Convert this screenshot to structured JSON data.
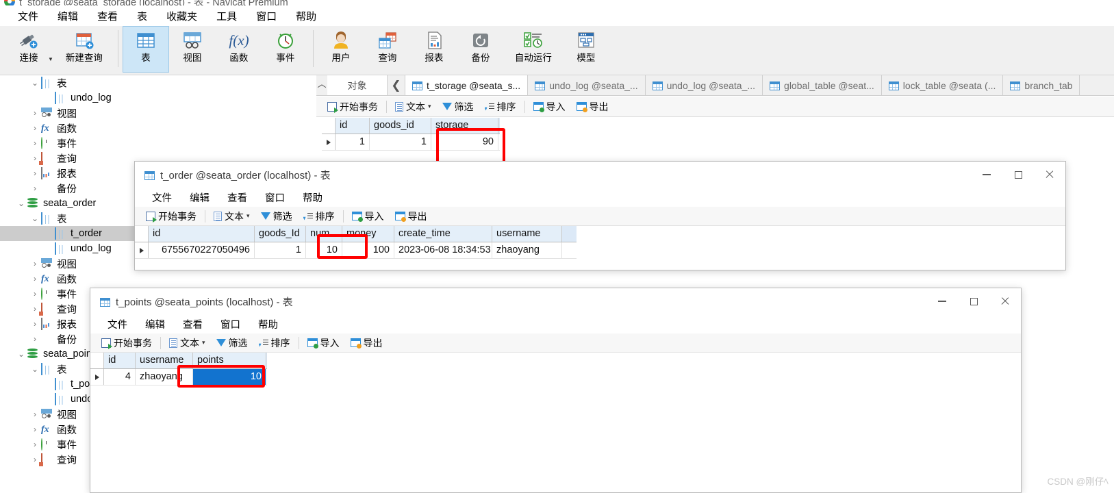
{
  "app": {
    "title": "t_storage @seata_storage (localhost) - 表 - Navicat Premium",
    "logo_name": "navicat-logo"
  },
  "menubar": {
    "items": [
      "文件",
      "编辑",
      "查看",
      "表",
      "收藏夹",
      "工具",
      "窗口",
      "帮助"
    ]
  },
  "ribbon": {
    "items": [
      {
        "label": "连接",
        "icon": "connection-icon"
      },
      {
        "label": "新建查询",
        "icon": "new-query-icon"
      },
      {
        "label": "表",
        "icon": "table-icon",
        "active": true
      },
      {
        "label": "视图",
        "icon": "view-icon"
      },
      {
        "label": "函数",
        "icon": "function-icon"
      },
      {
        "label": "事件",
        "icon": "event-icon"
      },
      {
        "label": "用户",
        "icon": "user-icon"
      },
      {
        "label": "查询",
        "icon": "query-icon"
      },
      {
        "label": "报表",
        "icon": "report-icon"
      },
      {
        "label": "备份",
        "icon": "backup-icon"
      },
      {
        "label": "自动运行",
        "icon": "automation-icon"
      },
      {
        "label": "模型",
        "icon": "model-icon"
      }
    ]
  },
  "sidebar": {
    "nodes": [
      {
        "label": "表",
        "indent": 1,
        "twisty": "down",
        "icon": "table-icon"
      },
      {
        "label": "undo_log",
        "indent": 2,
        "twisty": "none",
        "icon": "table-icon"
      },
      {
        "label": "视图",
        "indent": 1,
        "twisty": "right",
        "icon": "view-icon"
      },
      {
        "label": "函数",
        "indent": 1,
        "twisty": "right",
        "icon": "function-icon"
      },
      {
        "label": "事件",
        "indent": 1,
        "twisty": "right",
        "icon": "event-icon"
      },
      {
        "label": "查询",
        "indent": 1,
        "twisty": "right",
        "icon": "query-icon"
      },
      {
        "label": "报表",
        "indent": 1,
        "twisty": "right",
        "icon": "report-icon"
      },
      {
        "label": "备份",
        "indent": 1,
        "twisty": "right",
        "icon": "backup-icon"
      },
      {
        "label": "seata_order",
        "indent": 0,
        "twisty": "down",
        "icon": "database-icon"
      },
      {
        "label": "表",
        "indent": 1,
        "twisty": "down",
        "icon": "table-icon"
      },
      {
        "label": "t_order",
        "indent": 2,
        "twisty": "none",
        "icon": "table-icon",
        "selected": true
      },
      {
        "label": "undo_log",
        "indent": 2,
        "twisty": "none",
        "icon": "table-icon"
      },
      {
        "label": "视图",
        "indent": 1,
        "twisty": "right",
        "icon": "view-icon"
      },
      {
        "label": "函数",
        "indent": 1,
        "twisty": "right",
        "icon": "function-icon"
      },
      {
        "label": "事件",
        "indent": 1,
        "twisty": "right",
        "icon": "event-icon"
      },
      {
        "label": "查询",
        "indent": 1,
        "twisty": "right",
        "icon": "query-icon"
      },
      {
        "label": "报表",
        "indent": 1,
        "twisty": "right",
        "icon": "report-icon"
      },
      {
        "label": "备份",
        "indent": 1,
        "twisty": "right",
        "icon": "backup-icon"
      },
      {
        "label": "seata_points",
        "indent": 0,
        "twisty": "down",
        "icon": "database-icon"
      },
      {
        "label": "表",
        "indent": 1,
        "twisty": "down",
        "icon": "table-icon"
      },
      {
        "label": "t_points",
        "indent": 2,
        "twisty": "none",
        "icon": "table-icon"
      },
      {
        "label": "undo_log",
        "indent": 2,
        "twisty": "none",
        "icon": "table-icon"
      },
      {
        "label": "视图",
        "indent": 1,
        "twisty": "right",
        "icon": "view-icon"
      },
      {
        "label": "函数",
        "indent": 1,
        "twisty": "right",
        "icon": "function-icon"
      },
      {
        "label": "事件",
        "indent": 1,
        "twisty": "right",
        "icon": "event-icon"
      },
      {
        "label": "查询",
        "indent": 1,
        "twisty": "right",
        "icon": "query-icon"
      }
    ]
  },
  "main_panel": {
    "object_tab_label": "对象",
    "tabs": [
      {
        "label": "t_storage @seata_s...",
        "active": true
      },
      {
        "label": "undo_log @seata_...",
        "active": false
      },
      {
        "label": "undo_log @seata_...",
        "active": false
      },
      {
        "label": "global_table @seat...",
        "active": false
      },
      {
        "label": "lock_table @seata (...",
        "active": false
      },
      {
        "label": "branch_tab",
        "active": false
      }
    ],
    "toolbar": {
      "begin_transaction": "开始事务",
      "text": "文本",
      "filter": "筛选",
      "sort": "排序",
      "import": "导入",
      "export": "导出"
    },
    "grid": {
      "columns": [
        "id",
        "goods_id",
        "storage"
      ],
      "rows": [
        [
          "1",
          "1",
          "90"
        ]
      ],
      "highlighted_column": "storage",
      "highlighted_value": "90"
    }
  },
  "order_window": {
    "title": "t_order @seata_order (localhost) - 表",
    "icon": "table-icon",
    "menu": [
      "文件",
      "编辑",
      "查看",
      "窗口",
      "帮助"
    ],
    "toolbar": {
      "begin_transaction": "开始事务",
      "text": "文本",
      "filter": "筛选",
      "sort": "排序",
      "import": "导入",
      "export": "导出"
    },
    "controls": {
      "minimize": "minimize-icon",
      "maximize": "maximize-icon",
      "close": "close-icon"
    },
    "grid": {
      "columns": [
        "id",
        "goods_Id",
        "num",
        "money",
        "create_time",
        "username"
      ],
      "rows": [
        [
          "6755670227050496",
          "1",
          "10",
          "100",
          "2023-06-08 18:34:53",
          "zhaoyang"
        ]
      ],
      "highlighted_column": "num",
      "highlighted_value": "10"
    }
  },
  "points_window": {
    "title": "t_points @seata_points (localhost) - 表",
    "icon": "table-icon",
    "menu": [
      "文件",
      "编辑",
      "查看",
      "窗口",
      "帮助"
    ],
    "toolbar": {
      "begin_transaction": "开始事务",
      "text": "文本",
      "filter": "筛选",
      "sort": "排序",
      "import": "导入",
      "export": "导出"
    },
    "controls": {
      "minimize": "minimize-icon",
      "maximize": "maximize-icon",
      "close": "close-icon"
    },
    "grid": {
      "columns": [
        "id",
        "username",
        "points"
      ],
      "rows": [
        [
          "4",
          "zhaoyang",
          "10"
        ]
      ],
      "selected_cell": "points",
      "selected_value": "10",
      "selection_color": "#1273cf"
    }
  },
  "annotation": {
    "color": "#ff0000"
  },
  "watermark": {
    "text": "CSDN @刚仔ﾍ"
  }
}
